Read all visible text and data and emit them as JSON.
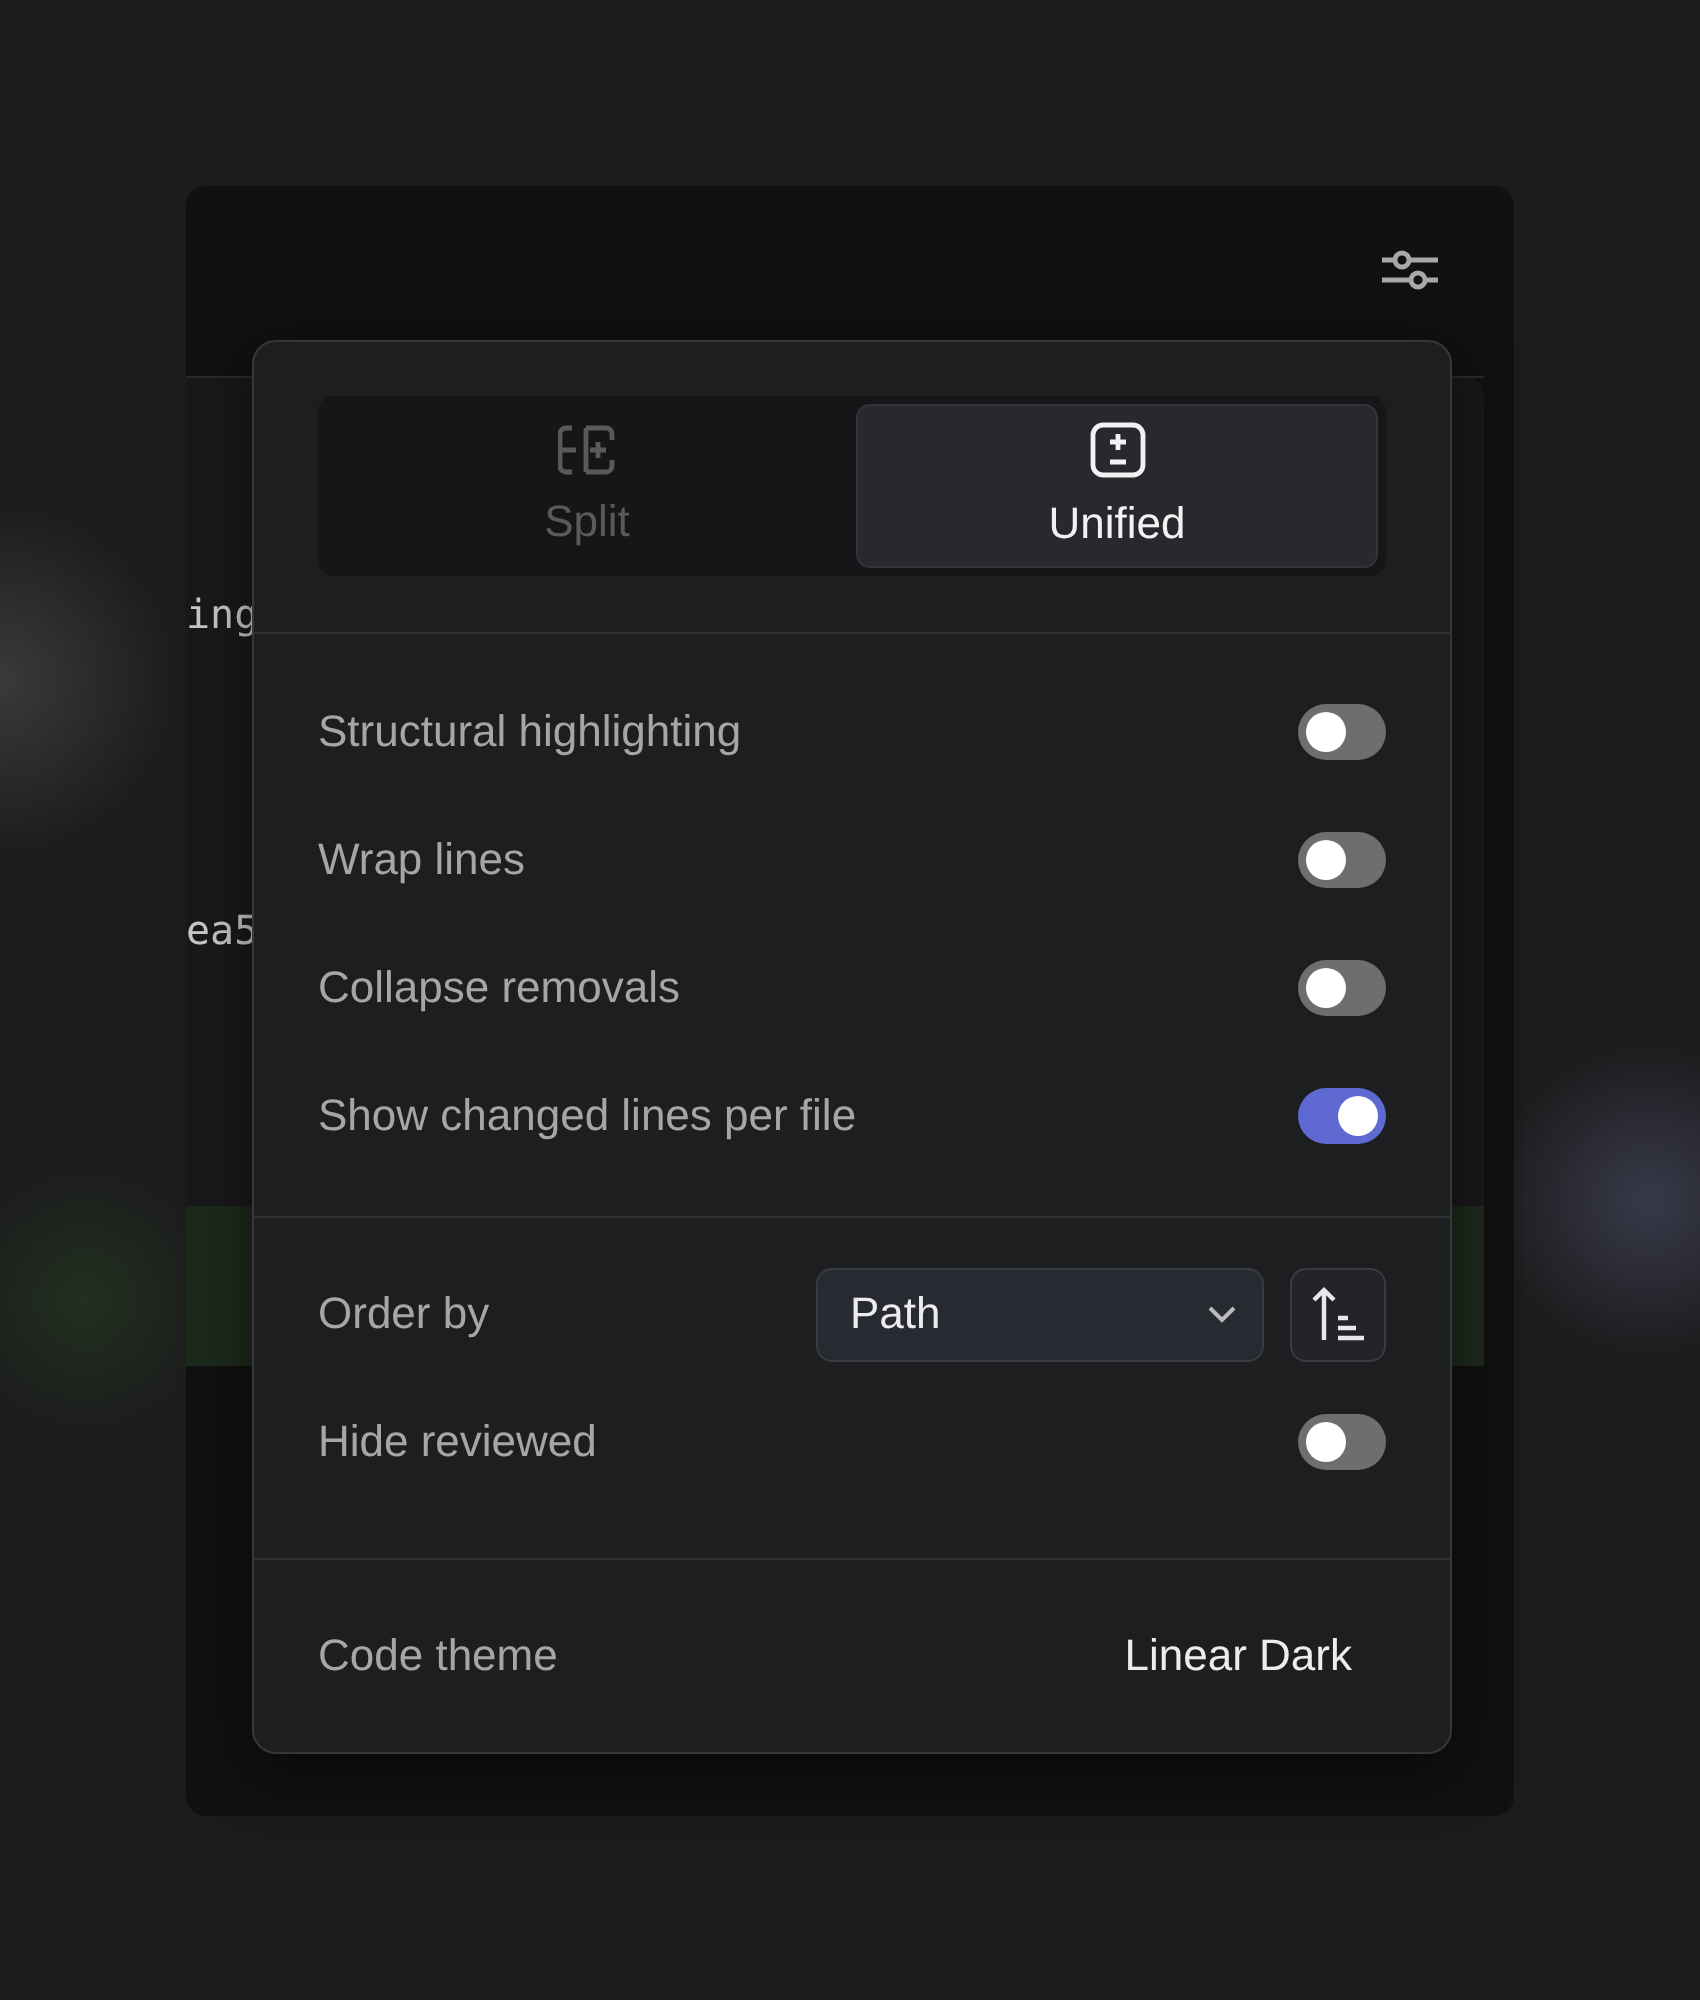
{
  "background_code": {
    "lines": [
      {
        "text": "ing",
        "added": false
      },
      {
        "text": "ea5",
        "added": false
      },
      {
        "added": true
      }
    ]
  },
  "view_modes": [
    {
      "label": "Split",
      "kind": "split",
      "selected": false
    },
    {
      "label": "Unified",
      "kind": "unified",
      "selected": true
    }
  ],
  "toggles": [
    {
      "label": "Structural highlighting",
      "on": false
    },
    {
      "label": "Wrap lines",
      "on": false
    },
    {
      "label": "Collapse removals",
      "on": false
    },
    {
      "label": "Show changed lines per file",
      "on": true
    }
  ],
  "order_by": {
    "label": "Order by",
    "value": "Path"
  },
  "hide_reviewed": {
    "label": "Hide reviewed",
    "on": false
  },
  "code_theme": {
    "label": "Code theme",
    "value": "Linear Dark"
  }
}
